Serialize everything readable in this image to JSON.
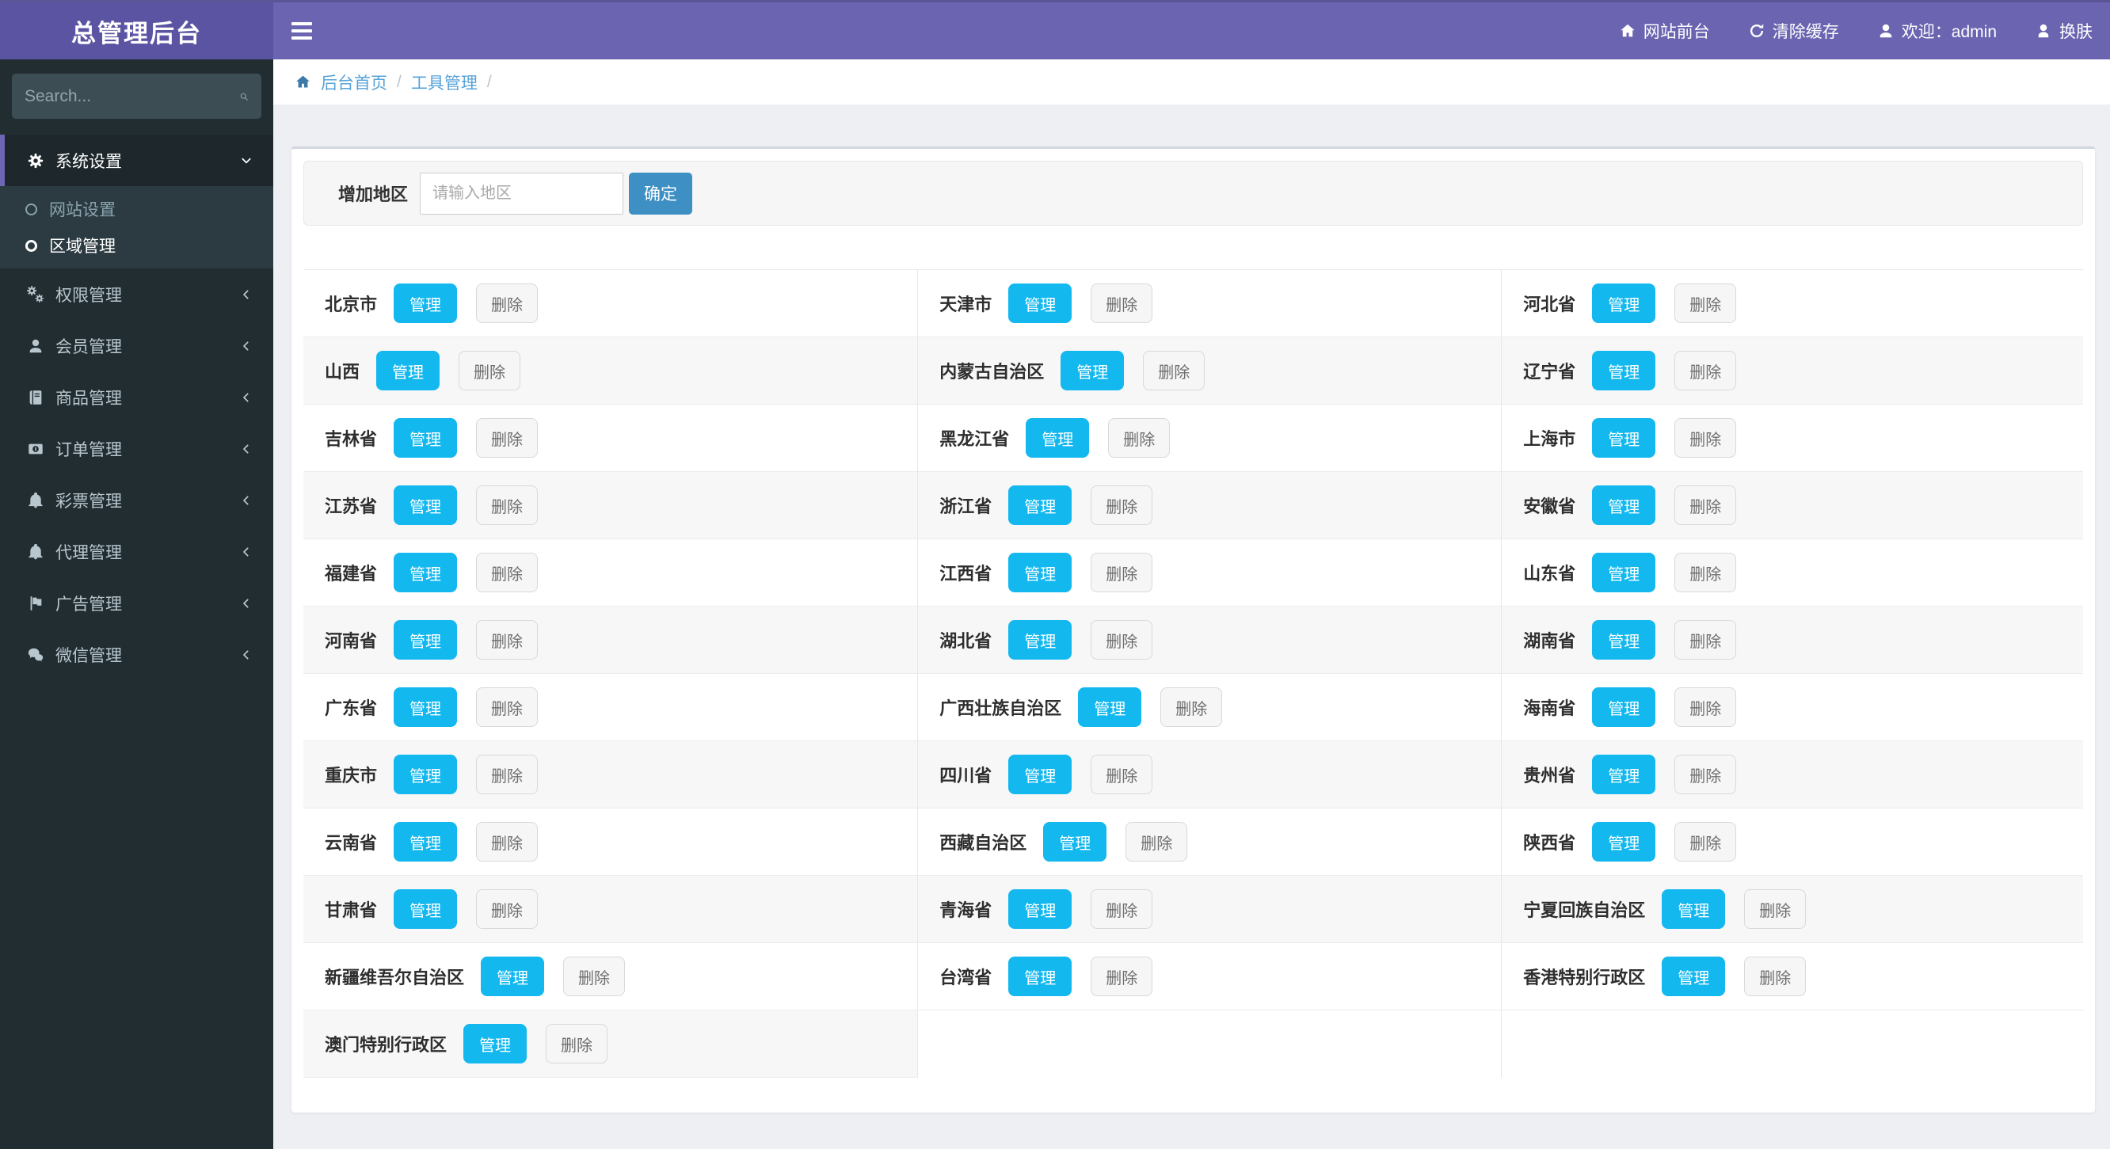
{
  "topbar": {
    "title": "总管理后台",
    "items": [
      {
        "label": "网站前台",
        "icon": "home-icon"
      },
      {
        "label": "清除缓存",
        "icon": "refresh-icon"
      },
      {
        "label": "欢迎：admin",
        "icon": "user-icon"
      },
      {
        "label": "换肤",
        "icon": "skin-icon"
      }
    ]
  },
  "sidebar": {
    "search_placeholder": "Search...",
    "menu": [
      {
        "label": "系统设置",
        "icon": "gear-icon",
        "state": "expanded",
        "children": [
          {
            "label": "网站设置",
            "active": false
          },
          {
            "label": "区域管理",
            "active": true
          }
        ]
      },
      {
        "label": "权限管理",
        "icon": "gears-icon"
      },
      {
        "label": "会员管理",
        "icon": "user-icon"
      },
      {
        "label": "商品管理",
        "icon": "book-icon"
      },
      {
        "label": "订单管理",
        "icon": "order-icon"
      },
      {
        "label": "彩票管理",
        "icon": "bell-icon"
      },
      {
        "label": "代理管理",
        "icon": "bell-icon"
      },
      {
        "label": "广告管理",
        "icon": "flag-icon"
      },
      {
        "label": "微信管理",
        "icon": "wechat-icon"
      }
    ]
  },
  "breadcrumb": {
    "home": "后台首页",
    "section": "工具管理",
    "separator": "/"
  },
  "add_region_form": {
    "label": "增加地区",
    "input_placeholder": "请输入地区",
    "submit_label": "确定"
  },
  "regions": {
    "manage_label": "管理",
    "delete_label": "删除",
    "rows": [
      [
        "北京市",
        "天津市",
        "河北省"
      ],
      [
        "山西",
        "内蒙古自治区",
        "辽宁省"
      ],
      [
        "吉林省",
        "黑龙江省",
        "上海市"
      ],
      [
        "江苏省",
        "浙江省",
        "安徽省"
      ],
      [
        "福建省",
        "江西省",
        "山东省"
      ],
      [
        "河南省",
        "湖北省",
        "湖南省"
      ],
      [
        "广东省",
        "广西壮族自治区",
        "海南省"
      ],
      [
        "重庆市",
        "四川省",
        "贵州省"
      ],
      [
        "云南省",
        "西藏自治区",
        "陕西省"
      ],
      [
        "甘肃省",
        "青海省",
        "宁夏回族自治区"
      ],
      [
        "新疆维吾尔自治区",
        "台湾省",
        "香港特别行政区"
      ],
      [
        "澳门特别行政区",
        "",
        ""
      ]
    ]
  },
  "colors": {
    "navbar_purple": "#6b64b1",
    "logo_purple": "#5b54a3",
    "sidebar_dark": "#222d32",
    "accent_cyan": "#13b8ef",
    "primary_blue": "#3d8fc4",
    "breadcrumb_link": "#57a3d8"
  }
}
